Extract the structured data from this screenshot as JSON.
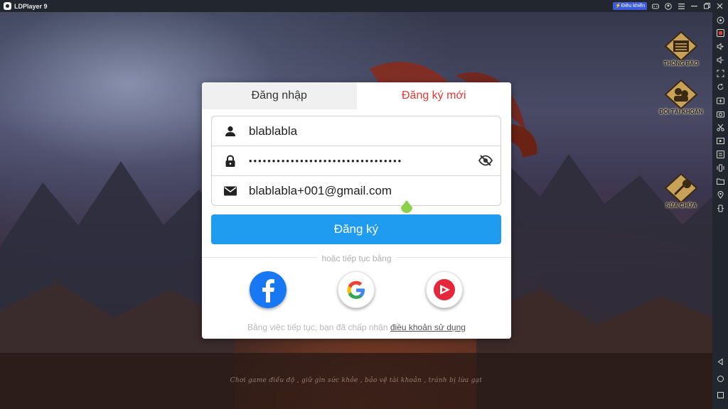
{
  "window": {
    "title": "LDPlayer 9",
    "control_badge": "⚡Điều khiển",
    "titlebar_icons": [
      "gamepad-icon",
      "account-icon",
      "menu-icon",
      "minimize-icon",
      "restore-icon",
      "close-icon"
    ]
  },
  "game": {
    "side_buttons": [
      {
        "label": "THÔNG BÁO",
        "icon": "notice-board-icon"
      },
      {
        "label": "ĐỔI TÀI KHOẢN",
        "icon": "switch-account-icon"
      },
      {
        "label": "SỬA CHỮA",
        "icon": "repair-wrench-icon"
      }
    ],
    "footer_warning": "Chơi game điều độ ,   giữ gìn sức khỏe ,   bảo vệ tài khoản ,   tránh bị lừa gạt"
  },
  "dialog": {
    "tabs": [
      {
        "label": "Đăng nhập",
        "active": false
      },
      {
        "label": "Đăng ký mới",
        "active": true
      }
    ],
    "username": {
      "value": "blablabla",
      "icon": "user-icon"
    },
    "password": {
      "masked": "•••••••••••••••••••••••••••••••••",
      "icon": "lock-icon",
      "toggle_icon": "eye-off-icon"
    },
    "email": {
      "value": "blablabla+001@gmail.com",
      "icon": "mail-icon"
    },
    "submit_label": "Đăng ký",
    "divider_text": "hoặc tiếp tục bằng",
    "social": [
      {
        "name": "Facebook",
        "icon": "facebook-icon"
      },
      {
        "name": "Google",
        "icon": "google-icon"
      },
      {
        "name": "Garena-like",
        "icon": "play-brand-icon"
      }
    ],
    "terms_prefix": "Bằng việc tiếp tục, bạn đã chấp nhận ",
    "terms_link": "điều khoản sử dụng"
  },
  "sidebar": {
    "icons": [
      "gamepad-icon",
      "keyboard-icon",
      "volume-up-icon",
      "volume-down-icon",
      "fullscreen-icon",
      "sync-icon",
      "add-apk-icon",
      "screenshot-icon",
      "scissors-icon",
      "record-icon",
      "operation-icon",
      "shake-icon",
      "folder-icon",
      "location-icon",
      "rotate-icon",
      "back-icon",
      "home-icon",
      "recent-apps-icon"
    ],
    "accent": "#1f9bf0"
  },
  "colors": {
    "brand_blue": "#1f9bf0",
    "active_tab_red": "#e53935",
    "facebook_blue": "#1877f2"
  }
}
